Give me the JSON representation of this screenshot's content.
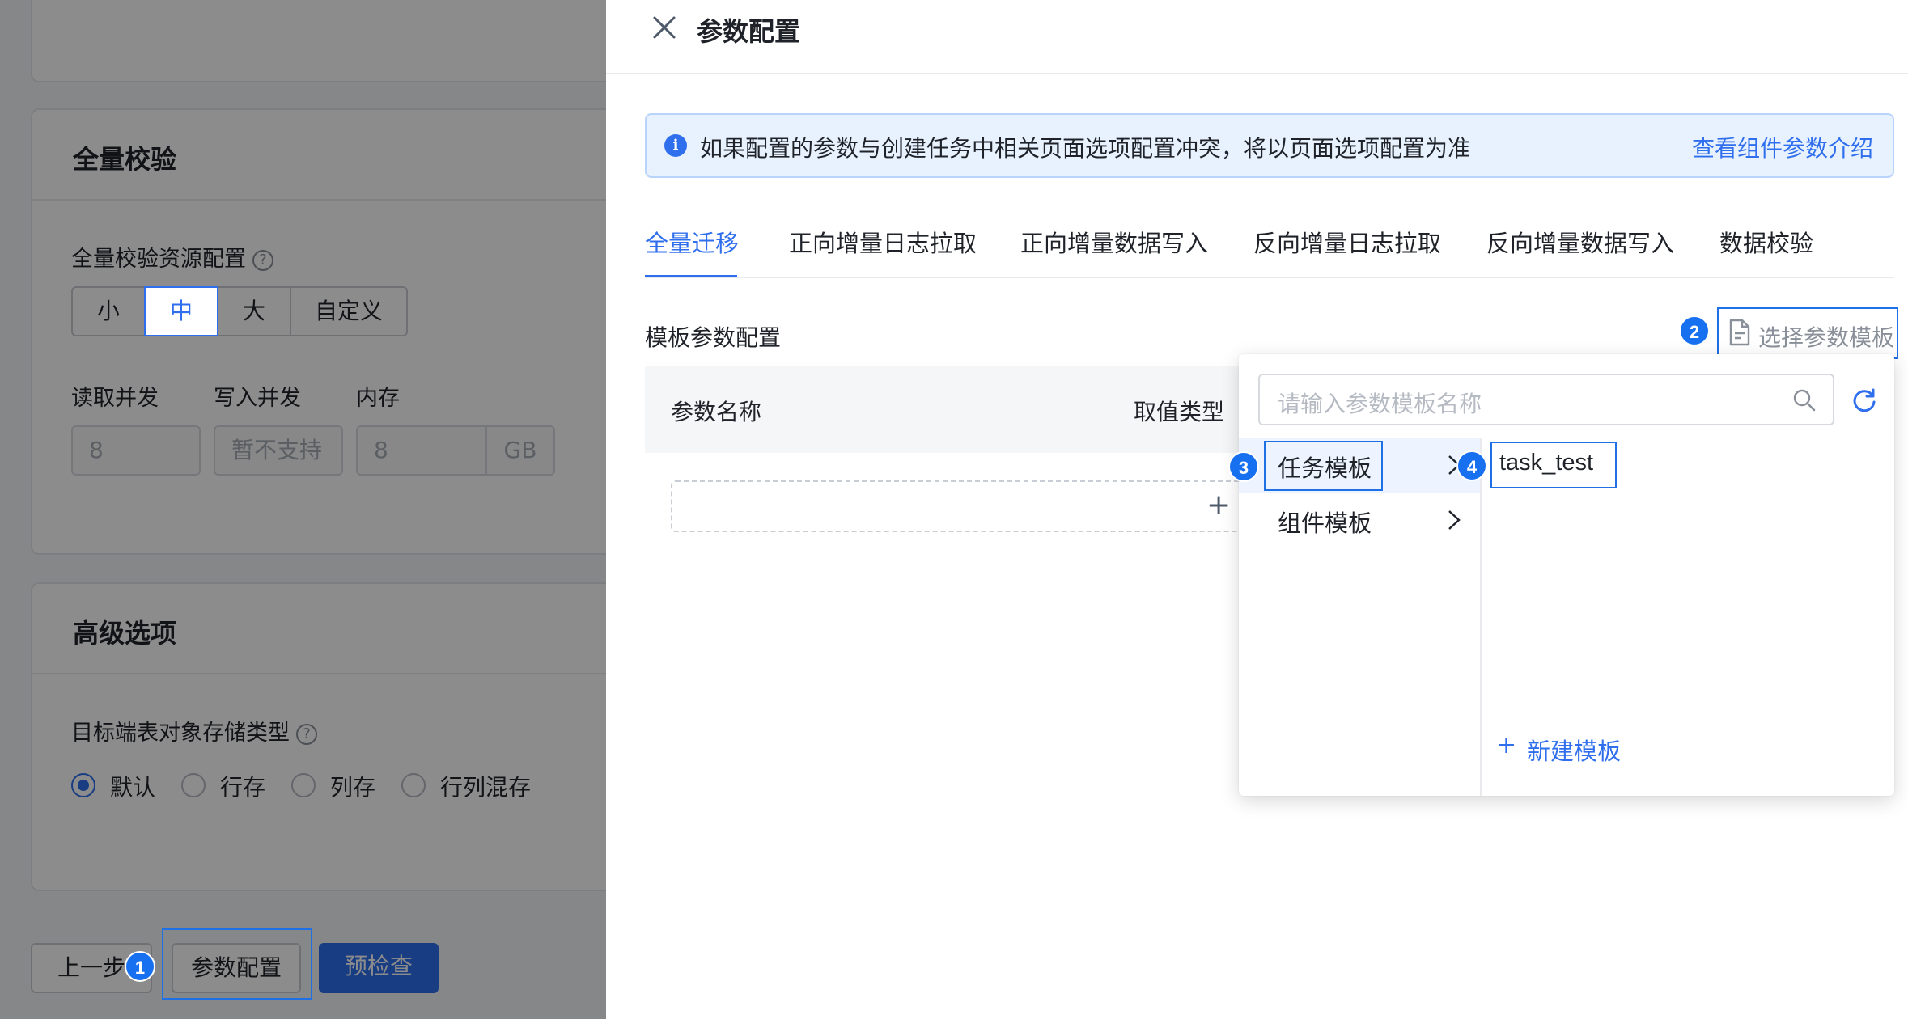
{
  "left": {
    "full_check": {
      "title": "全量校验",
      "resource_label": "全量校验资源配置",
      "help": "?",
      "sizes": [
        "小",
        "中",
        "大",
        "自定义"
      ],
      "read_label": "读取并发",
      "write_label": "写入并发",
      "memory_label": "内存",
      "read_value": "8",
      "write_value": "暂不支持",
      "memory_value": "8",
      "memory_unit": "GB"
    },
    "advanced": {
      "title": "高级选项",
      "storage_label": "目标端表对象存储类型",
      "options": [
        "默认",
        "行存",
        "列存",
        "行列混存"
      ]
    },
    "footer": {
      "prev": "上一步",
      "param_config": "参数配置",
      "precheck": "预检查"
    }
  },
  "drawer": {
    "title": "参数配置",
    "notice": "如果配置的参数与创建任务中相关页面选项配置冲突，将以页面选项配置为准",
    "notice_link": "查看组件参数介绍",
    "tabs": [
      "全量迁移",
      "正向增量日志拉取",
      "正向增量数据写入",
      "反向增量日志拉取",
      "反向增量数据写入",
      "数据校验"
    ],
    "section_title": "模板参数配置",
    "select_template": "选择参数模板",
    "table_headers": [
      "参数名称",
      "取值类型"
    ],
    "add_symbol": "+"
  },
  "popover": {
    "search_placeholder": "请输入参数模板名称",
    "categories": [
      "任务模板",
      "组件模板"
    ],
    "templates": [
      "task_test"
    ],
    "new_template": "新建模板"
  },
  "badges": [
    "1",
    "2",
    "3",
    "4"
  ],
  "colors": {
    "primary": "#2f6fed",
    "highlight": "#1f6fe5",
    "notice_bg": "#e8f2ff"
  }
}
